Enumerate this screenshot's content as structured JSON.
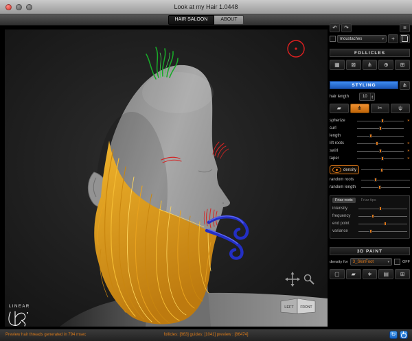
{
  "window": {
    "title": "Look at my Hair 1.0448",
    "tabs": [
      {
        "label": "HAIR SALOON"
      },
      {
        "label": "ABOUT"
      }
    ]
  },
  "glyphs": {
    "caret_down": "▾",
    "caret_up": "▴"
  },
  "colors": {
    "accent": "#e07818",
    "styling_blue": "#2b6fd8",
    "hair_gold": "#e8a21e",
    "status_orange": "#d97a1a"
  },
  "side": {
    "top_icons": [
      {
        "name": "undo-icon",
        "glyph": "↶"
      },
      {
        "name": "redo-icon",
        "glyph": "↷"
      },
      {
        "name": "options-icon",
        "glyph": "≡"
      }
    ],
    "preset": {
      "value": "moustaches",
      "add_label": "+"
    },
    "follicles": {
      "header": "FOLLICLES",
      "icons": [
        {
          "name": "follicles-grid-icon",
          "glyph": "▦"
        },
        {
          "name": "follicles-delete-icon",
          "glyph": "⊠"
        },
        {
          "name": "follicles-comb-icon",
          "glyph": "⋔"
        },
        {
          "name": "follicles-link-icon",
          "glyph": "⊕"
        },
        {
          "name": "follicles-mesh-icon",
          "glyph": "⊞"
        }
      ]
    },
    "styling": {
      "header": "STYLING",
      "comb_glyph": "⋔",
      "hair_length": {
        "label": "hair length",
        "value": "10"
      },
      "tools": [
        {
          "name": "brush-tool-icon",
          "glyph": "▰",
          "selected": false
        },
        {
          "name": "comb-tool-icon",
          "glyph": "⋔",
          "selected": true
        },
        {
          "name": "scissors-tool-icon",
          "glyph": "✂",
          "selected": false
        },
        {
          "name": "rake-tool-icon",
          "glyph": "ψ",
          "selected": false
        }
      ],
      "sliders": [
        {
          "label": "spherize",
          "value": 55,
          "marker": "∗"
        },
        {
          "label": "curl",
          "value": 50,
          "marker": ""
        },
        {
          "label": "length",
          "value": 30,
          "marker": ""
        },
        {
          "label": "lift roots",
          "value": 42,
          "marker": "∗"
        },
        {
          "label": "swirl",
          "value": 50,
          "marker": "∗"
        },
        {
          "label": "taper",
          "value": 55,
          "marker": "∗"
        }
      ],
      "density": {
        "label": "density",
        "value": 42
      },
      "random_sliders": [
        {
          "label": "random roots",
          "value": 30
        },
        {
          "label": "random length",
          "value": 38
        }
      ],
      "frizz": {
        "tabs": [
          {
            "label": "Frizz roots"
          },
          {
            "label": "Frizz tips"
          }
        ],
        "sliders": [
          {
            "label": "intensity",
            "value": 45
          },
          {
            "label": "frequency",
            "value": 30
          },
          {
            "label": "end point",
            "value": 55
          },
          {
            "label": "variance",
            "value": 25
          }
        ]
      }
    },
    "paint": {
      "header": "3D PAINT",
      "density_for_label": "density for",
      "surface": {
        "value": "3_SkinFoot"
      },
      "off_label": "OFF",
      "icons": [
        {
          "name": "clear-map-icon",
          "glyph": "▢"
        },
        {
          "name": "paint-brush-icon",
          "glyph": "▰"
        },
        {
          "name": "paw-print-icon",
          "glyph": "∗"
        },
        {
          "name": "fill-map-icon",
          "glyph": "▤"
        },
        {
          "name": "import-map-icon",
          "glyph": "⊞"
        }
      ]
    }
  },
  "viewport": {
    "cube_labels": [
      "LEFT",
      "FRONT"
    ],
    "watermark": "LINEAR"
  },
  "status": {
    "left": "Preview hair threads generated in 794 msec",
    "center": "follicles: [863] guides: [1041]   preview : [86474]",
    "icons": [
      {
        "name": "sync-icon",
        "glyph": "↻"
      },
      {
        "name": "power-icon"
      }
    ]
  }
}
